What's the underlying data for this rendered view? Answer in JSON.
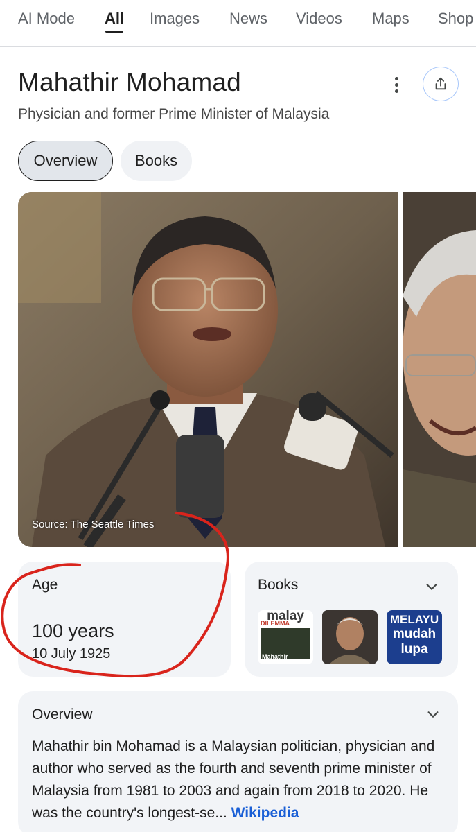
{
  "tabs": [
    "AI Mode",
    "All",
    "Images",
    "News",
    "Videos",
    "Maps",
    "Shop"
  ],
  "entity": {
    "title": "Mahathir Mohamad",
    "subtitle": "Physician and former Prime Minister of Malaysia"
  },
  "chips": {
    "overview": "Overview",
    "books": "Books"
  },
  "photo": {
    "source": "Source: The Seattle Times"
  },
  "age_card": {
    "label": "Age",
    "value": "100 years",
    "date": "10 July 1925"
  },
  "books_card": {
    "label": "Books",
    "covers": [
      {
        "title_top": "malay",
        "title_sub": "DILEMMA",
        "author": "Mahathir"
      },
      {
        "title_top": ""
      },
      {
        "title_top": "MELAYU",
        "title_mid": "mudah",
        "title_bottom": "lupa"
      }
    ]
  },
  "overview_card": {
    "label": "Overview",
    "text": "Mahathir bin Mohamad is a Malaysian politician, physician and author who served as the fourth and seventh prime minister of Malaysia from 1981 to 2003 and again from 2018 to 2020. He was the country's longest-se...",
    "link": "Wikipedia"
  },
  "colors": {
    "link": "#1a5fd6",
    "annotation": "#d9241c",
    "card_bg": "#f2f4f7"
  },
  "icons": [
    "more-vert-icon",
    "share-icon",
    "chevron-down-icon"
  ]
}
